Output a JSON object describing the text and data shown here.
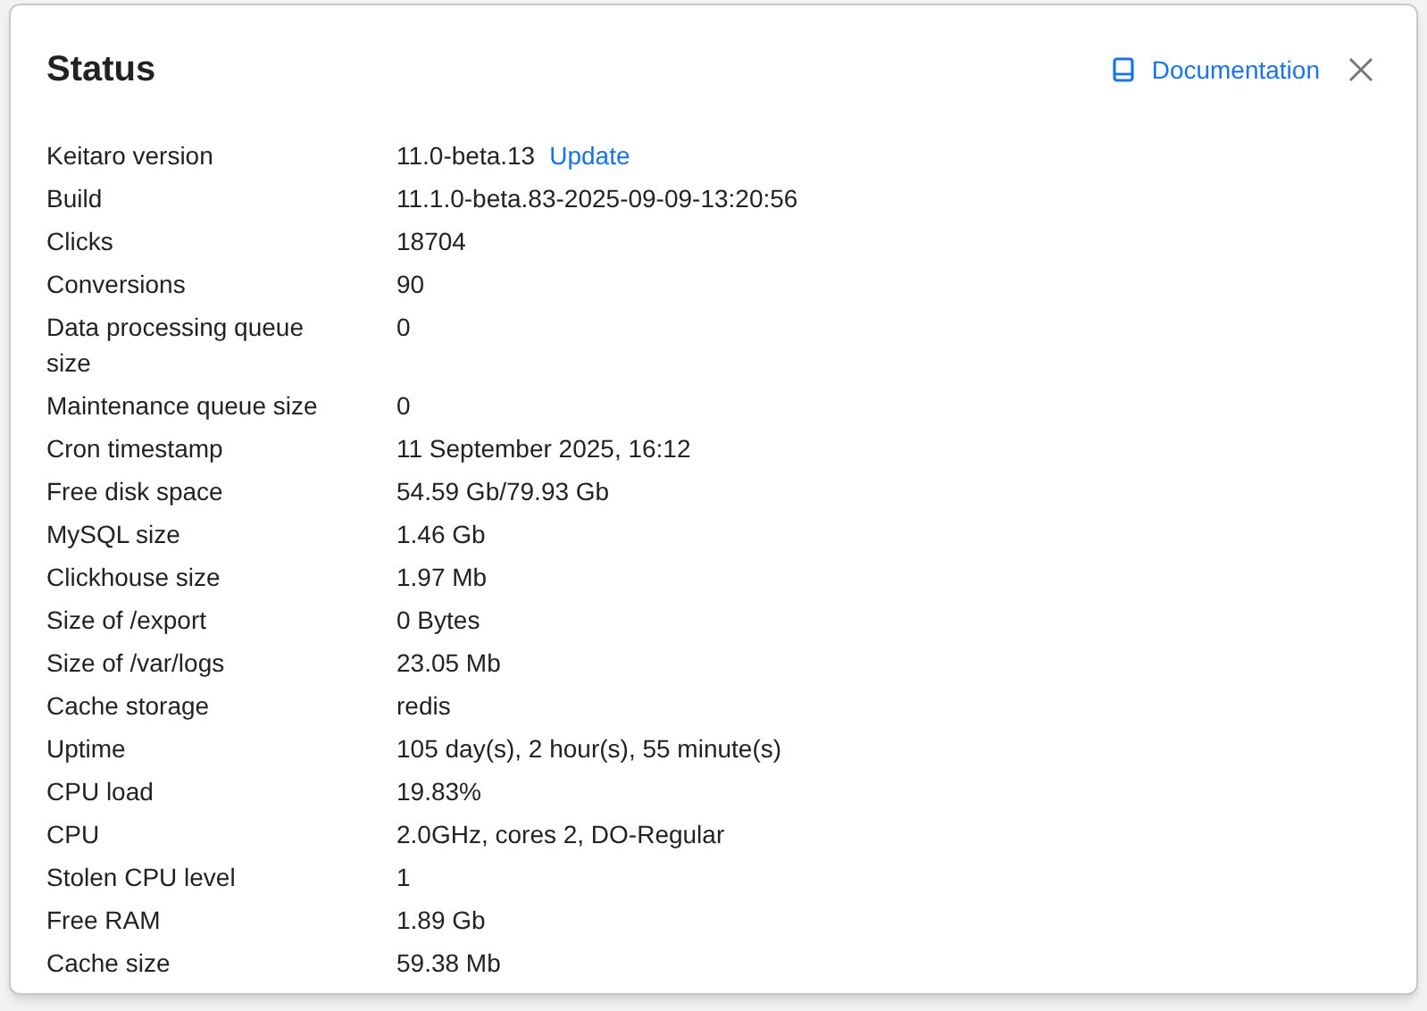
{
  "dialog": {
    "title": "Status",
    "doc_link": "Documentation"
  },
  "rows": [
    {
      "label": "Keitaro version",
      "value": "11.0-beta.13",
      "link": "Update"
    },
    {
      "label": "Build",
      "value": "11.1.0-beta.83-2025-09-09-13:20:56"
    },
    {
      "label": "Clicks",
      "value": "18704"
    },
    {
      "label": "Conversions",
      "value": "90"
    },
    {
      "label": "Data processing queue size",
      "value": "0"
    },
    {
      "label": "Maintenance queue size",
      "value": "0"
    },
    {
      "label": "Cron timestamp",
      "value": "11 September 2025, 16:12"
    },
    {
      "label": "Free disk space",
      "value": "54.59 Gb/79.93 Gb"
    },
    {
      "label": "MySQL size",
      "value": "1.46 Gb"
    },
    {
      "label": "Clickhouse size",
      "value": "1.97 Mb"
    },
    {
      "label": "Size of /export",
      "value": "0 Bytes"
    },
    {
      "label": "Size of /var/logs",
      "value": "23.05 Mb"
    },
    {
      "label": "Cache storage",
      "value": "redis"
    },
    {
      "label": "Uptime",
      "value": "105 day(s), 2 hour(s), 55 minute(s)"
    },
    {
      "label": "CPU load",
      "value": "19.83%"
    },
    {
      "label": "CPU",
      "value": "2.0GHz, cores 2, DO-Regular"
    },
    {
      "label": "Stolen CPU level",
      "value": "1"
    },
    {
      "label": "Free RAM",
      "value": "1.89 Gb"
    },
    {
      "label": "Cache size",
      "value": "59.38 Mb"
    }
  ]
}
